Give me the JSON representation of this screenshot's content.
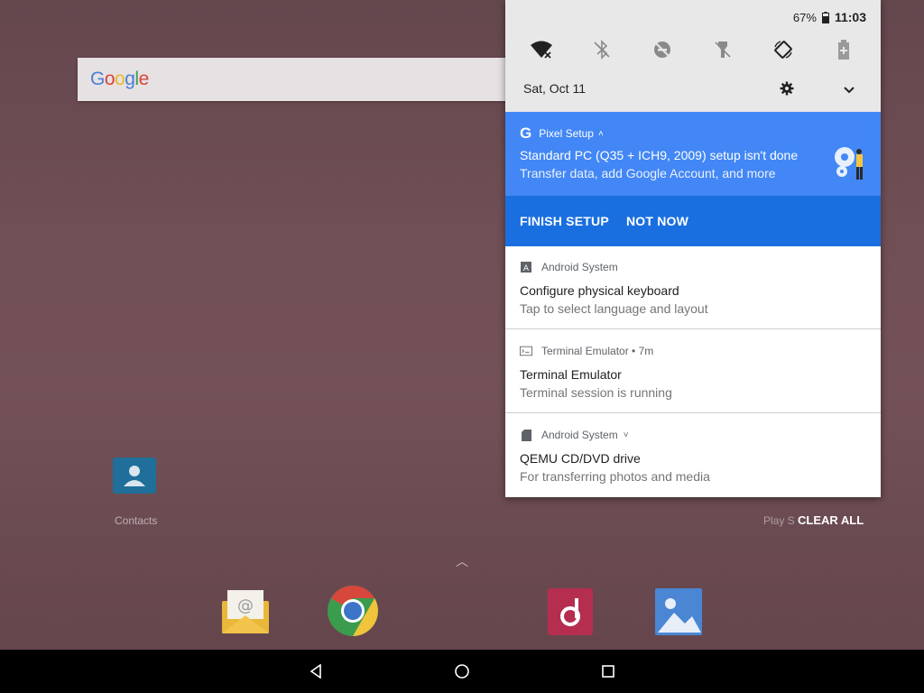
{
  "home": {
    "search_logo": "Google",
    "contacts_label": "Contacts",
    "playstore_label": "Play S",
    "dock": [
      {
        "name": "email"
      },
      {
        "name": "chrome"
      },
      {
        "name": "music"
      },
      {
        "name": "gallery"
      }
    ]
  },
  "status": {
    "battery_percent": "67%",
    "time": "11:03"
  },
  "quick_settings": {
    "date": "Sat, Oct 11",
    "icons": [
      "wifi-off-icon",
      "bluetooth-off-icon",
      "dnd-off-icon",
      "flashlight-off-icon",
      "auto-rotate-icon",
      "battery-saver-icon"
    ]
  },
  "pixel_setup": {
    "app_name": "Pixel Setup",
    "title": "Standard PC (Q35 + ICH9, 2009) setup isn't done",
    "text": "Transfer data, add Google Account, and more",
    "finish_label": "FINISH SETUP",
    "not_now_label": "NOT NOW",
    "card_color": "#4287f5",
    "actions_color": "#1a6fe0"
  },
  "notifications": [
    {
      "app": "Android System",
      "title": "Configure physical keyboard",
      "text": "Tap to select language and layout"
    },
    {
      "app": "Terminal Emulator • 7m",
      "title": "Terminal Emulator",
      "text": "Terminal session is running"
    },
    {
      "app": "Android System",
      "title": "QEMU CD/DVD drive",
      "text": "For transferring photos and media"
    }
  ],
  "clear_all_label": "CLEAR ALL"
}
